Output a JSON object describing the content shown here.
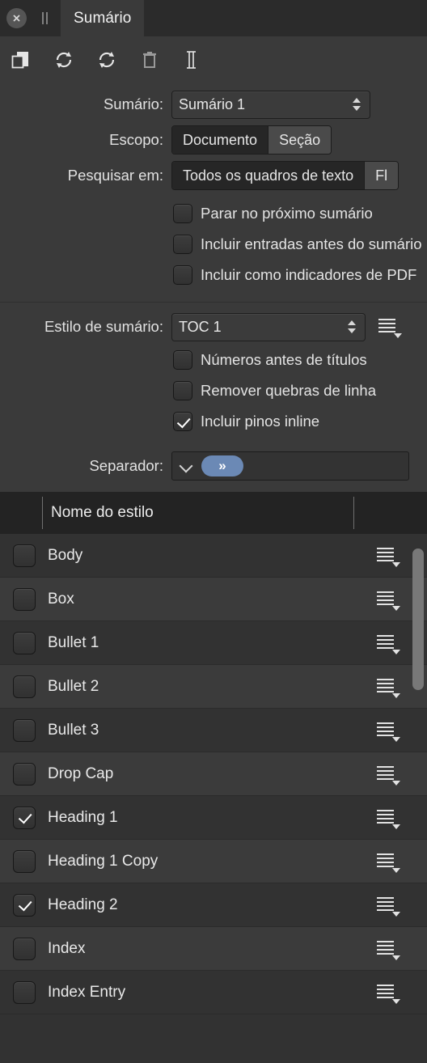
{
  "titlebar": {
    "close_icon": "close-circle-icon",
    "grip_icon": "drag-grip-icon",
    "tab_label": "Sumário"
  },
  "toolbar": {
    "buttons": [
      {
        "name": "duplicate-icon",
        "label": "Duplicar"
      },
      {
        "name": "refresh-icon",
        "label": "Atualizar"
      },
      {
        "name": "refresh-all-icon",
        "label": "Atualizar tudo"
      },
      {
        "name": "trash-icon",
        "label": "Excluir"
      },
      {
        "name": "text-cursor-icon",
        "label": "Inserir texto"
      }
    ]
  },
  "form": {
    "toc_label": "Sumário:",
    "toc_value": "Sumário 1",
    "scope_label": "Escopo:",
    "scope_options": [
      "Documento",
      "Seção"
    ],
    "scope_selected": "Seção",
    "search_label": "Pesquisar em:",
    "search_options": [
      "Todos os quadros de texto",
      "Fl"
    ],
    "search_selected": "Todos os quadros de texto",
    "checkboxes": [
      {
        "label": "Parar no próximo sumário",
        "checked": false
      },
      {
        "label": "Incluir entradas antes do sumário",
        "checked": false
      },
      {
        "label": "Incluir como indicadores de PDF",
        "checked": false
      }
    ]
  },
  "style_section": {
    "style_label": "Estilo de sumário:",
    "style_value": "TOC 1",
    "menu_icon": "list-menu-icon",
    "checkboxes": [
      {
        "label": "Números antes de títulos",
        "checked": false
      },
      {
        "label": "Remover quebras de linha",
        "checked": false
      },
      {
        "label": "Incluir pinos inline",
        "checked": true
      }
    ],
    "separator_label": "Separador:",
    "separator_chevron_icon": "chevron-down-icon",
    "separator_token": "»",
    "separator_token_color": "#6b89b5"
  },
  "list": {
    "column_header": "Nome do estilo",
    "rows": [
      {
        "name": "Body",
        "checked": false
      },
      {
        "name": "Box",
        "checked": false
      },
      {
        "name": "Bullet 1",
        "checked": false
      },
      {
        "name": "Bullet 2",
        "checked": false
      },
      {
        "name": "Bullet 3",
        "checked": false
      },
      {
        "name": "Drop Cap",
        "checked": false
      },
      {
        "name": "Heading 1",
        "checked": true
      },
      {
        "name": "Heading 1 Copy",
        "checked": false
      },
      {
        "name": "Heading 2",
        "checked": true
      },
      {
        "name": "Index",
        "checked": false
      },
      {
        "name": "Index Entry",
        "checked": false
      }
    ],
    "row_menu_icon": "list-menu-icon",
    "scrollbar": {
      "name": "vertical-scrollbar",
      "thumb_top_pct": 2,
      "thumb_height_pct": 27
    }
  },
  "colors": {
    "panel_bg": "#3a3a3a",
    "titlebar_bg": "#2b2b2b",
    "list_header_bg": "#232323",
    "row_odd": "#323232",
    "row_even": "#3b3b3b",
    "accent": "#6b89b5"
  }
}
